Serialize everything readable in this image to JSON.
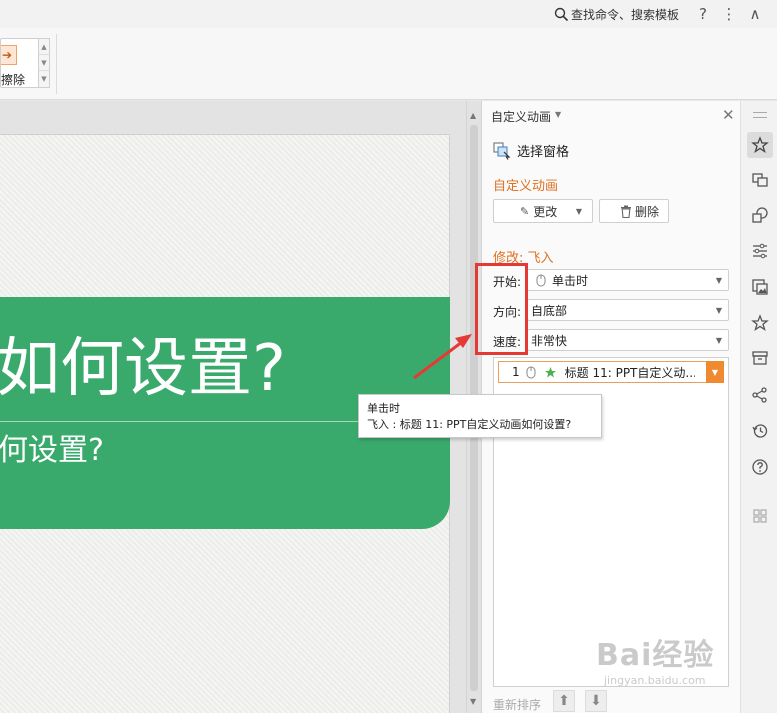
{
  "topbar": {
    "search_command": "查找命令、搜索模板",
    "help": "?",
    "more": "⋮",
    "collapse": "∧"
  },
  "ribbon": {
    "erase_label": "擦除"
  },
  "slide": {
    "title": "如何设置?",
    "subtitle": "何设置?"
  },
  "pane": {
    "title": "自定义动画",
    "select_pane": "选择窗格",
    "section_custom": "自定义动画",
    "change_button": "更改",
    "delete_button": "删除",
    "modify_label": "修改: 飞入",
    "start_label": "开始:",
    "start_value": "单击时",
    "direction_label": "方向:",
    "direction_value": "自底部",
    "speed_label": "速度:",
    "speed_value": "非常快",
    "list_items": [
      {
        "index": "1",
        "text": "标题 11: PPT自定义动..."
      }
    ],
    "reorder_label": "重新排序"
  },
  "tooltip": {
    "line1": "单击时",
    "line2": "飞入 : 标题 11: PPT自定义动画如何设置?"
  },
  "watermark": {
    "logo": "Bai经验",
    "url": "jingyan.baidu.com"
  },
  "colors": {
    "slide_green": "#3aaa6c",
    "accent_orange": "#e07020",
    "annotation_red": "#e53935"
  },
  "icons": {
    "sidebar": [
      "animation-star-icon",
      "transition-icon",
      "shapes-icon",
      "properties-icon",
      "image-icon",
      "star-icon",
      "archive-icon",
      "share-icon",
      "history-icon",
      "help-icon",
      "apps-icon"
    ]
  }
}
